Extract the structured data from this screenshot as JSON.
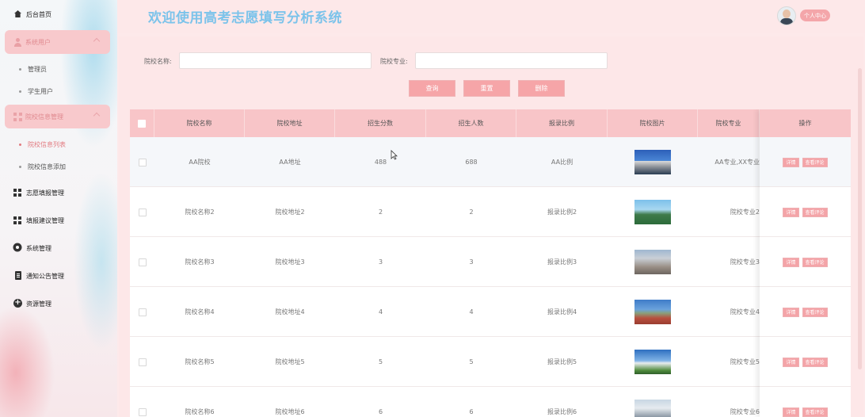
{
  "app": {
    "title": "欢迎使用高考志愿填写分析系统",
    "user_button": "个人中心"
  },
  "sidebar": {
    "home": "后台首页",
    "system_users": "系统用户",
    "users_sub": [
      "管理员",
      "学生用户"
    ],
    "school_info": "院校信息管理",
    "school_sub": [
      "院校信息列表",
      "院校信息添加"
    ],
    "menu": [
      "志愿填报管理",
      "填报建议管理",
      "系统管理",
      "通知公告管理",
      "资源管理"
    ]
  },
  "search": {
    "school_name_label": "院校名称:",
    "school_name_value": "",
    "major_label": "院校专业:",
    "major_value": "",
    "query_button": "查询",
    "reset_button": "重置",
    "delete_button": "删除"
  },
  "table": {
    "headers": [
      "院校名称",
      "院校地址",
      "招生分数",
      "招生人数",
      "报录比例",
      "院校图片",
      "院校专业",
      "操作"
    ],
    "op_detail": "详情",
    "op_comment": "查看评论",
    "rows": [
      {
        "name": "AA院校",
        "address": "AA地址",
        "score": "488",
        "count": "688",
        "ratio": "AA比例",
        "major": "AA专业,XX专业"
      },
      {
        "name": "院校名称2",
        "address": "院校地址2",
        "score": "2",
        "count": "2",
        "ratio": "报录比例2",
        "major": "院校专业2"
      },
      {
        "name": "院校名称3",
        "address": "院校地址3",
        "score": "3",
        "count": "3",
        "ratio": "报录比例3",
        "major": "院校专业3"
      },
      {
        "name": "院校名称4",
        "address": "院校地址4",
        "score": "4",
        "count": "4",
        "ratio": "报录比例4",
        "major": "院校专业4"
      },
      {
        "name": "院校名称5",
        "address": "院校地址5",
        "score": "5",
        "count": "5",
        "ratio": "报录比例5",
        "major": "院校专业5"
      },
      {
        "name": "院校名称6",
        "address": "院校地址6",
        "score": "6",
        "count": "6",
        "ratio": "报录比例6",
        "major": "院校专业6"
      }
    ]
  },
  "colors": {
    "accent": "#f6a5a8",
    "title": "#7cc3ea",
    "header_bg": "#f8c5c8"
  }
}
